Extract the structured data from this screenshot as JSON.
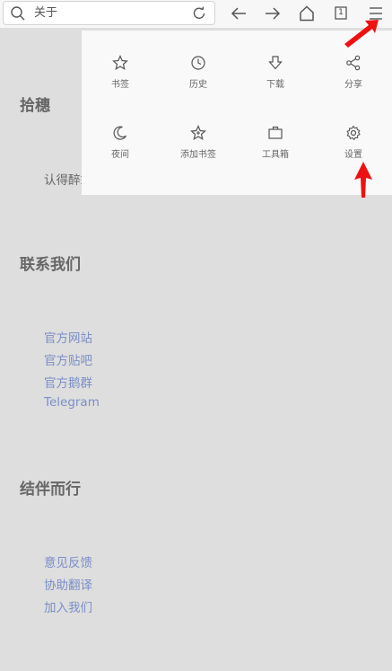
{
  "toolbar": {
    "search_text": "关于",
    "tab_count": "1"
  },
  "page": {
    "section1_title": "拾穗",
    "section1_text": "认得醉翁语，山色有无中。",
    "section2_title": "联系我们",
    "contact_links": [
      "官方网站",
      "官方贴吧",
      "官方鹅群",
      "Telegram"
    ],
    "section3_title": "结伴而行",
    "together_links": [
      "意见反馈",
      "协助翻译",
      "加入我们"
    ]
  },
  "menu": {
    "items": [
      {
        "label": "书签",
        "icon": "star-icon"
      },
      {
        "label": "历史",
        "icon": "clock-icon"
      },
      {
        "label": "下载",
        "icon": "download-arrow-icon"
      },
      {
        "label": "分享",
        "icon": "share-icon"
      },
      {
        "label": "夜间",
        "icon": "moon-icon"
      },
      {
        "label": "添加书签",
        "icon": "star-plus-icon"
      },
      {
        "label": "工具箱",
        "icon": "toolbox-icon"
      },
      {
        "label": "设置",
        "icon": "gear-icon"
      }
    ]
  },
  "colors": {
    "background": "#dedede",
    "menu_background": "#f9f9f9",
    "link": "#7a8ec8",
    "annotation_arrow": "#ee1111"
  }
}
